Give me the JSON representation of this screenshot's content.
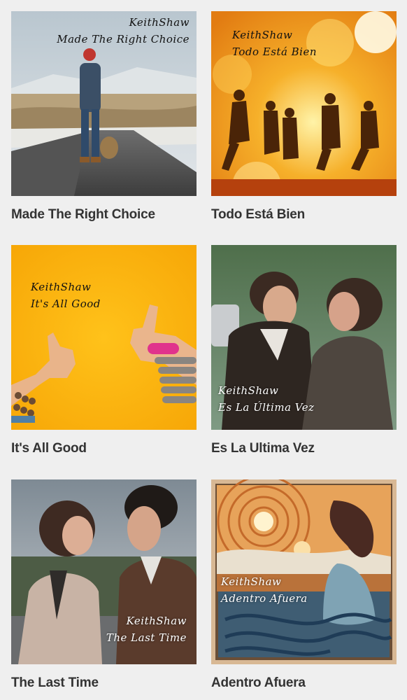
{
  "albums": [
    {
      "artist": "KeithShaw",
      "cover_title": "Made The Right Choice",
      "title": "Made The Right Choice"
    },
    {
      "artist": "KeithShaw",
      "cover_title": "Todo Está Bien",
      "title": "Todo Está Bien"
    },
    {
      "artist": "KeithShaw",
      "cover_title": "It's All Good",
      "title": "It's All Good"
    },
    {
      "artist": "KeithShaw",
      "cover_title": "Es La Última Vez",
      "title": "Es La Ultima Vez"
    },
    {
      "artist": "KeithShaw",
      "cover_title": "The Last Time",
      "title": "The Last Time"
    },
    {
      "artist": "KeithShaw",
      "cover_title": "Adentro Afuera",
      "title": "Adentro Afuera"
    }
  ]
}
